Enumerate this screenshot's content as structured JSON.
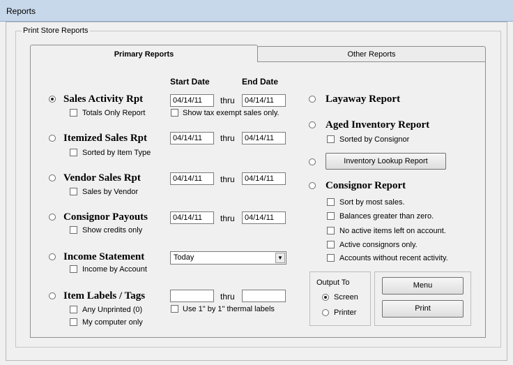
{
  "window": {
    "title": "Reports"
  },
  "group_label": "Print Store Reports",
  "tabs": [
    "Primary Reports",
    "Other Reports"
  ],
  "headers": {
    "start": "Start Date",
    "end": "End Date"
  },
  "thru": "thru",
  "left": [
    {
      "label": "Sales Activity Rpt",
      "checked": true,
      "option": "Totals Only Report",
      "start": "04/14/11",
      "end": "04/14/11",
      "extra": "Show tax exempt sales only."
    },
    {
      "label": "Itemized Sales Rpt",
      "checked": false,
      "option": "Sorted by Item Type",
      "start": "04/14/11",
      "end": "04/14/11"
    },
    {
      "label": "Vendor Sales Rpt",
      "checked": false,
      "option": "Sales by Vendor",
      "start": "04/14/11",
      "end": "04/14/11"
    },
    {
      "label": "Consignor Payouts",
      "checked": false,
      "option": "Show credits only",
      "start": "04/14/11",
      "end": "04/14/11"
    },
    {
      "label": "Income Statement",
      "checked": false,
      "option": "Income by Account",
      "select": "Today"
    },
    {
      "label": "Item Labels / Tags",
      "checked": false,
      "option": "Any Unprinted  (0)",
      "option2": "My computer only",
      "start": "",
      "end": "",
      "extra": "Use 1\" by 1\" thermal labels"
    }
  ],
  "right": {
    "layaway": "Layaway Report",
    "aged": "Aged Inventory Report",
    "aged_option": "Sorted by Consignor",
    "lookup_button": "Inventory Lookup Report",
    "consignor": "Consignor Report",
    "consignor_options": [
      "Sort by most sales.",
      "Balances greater than zero.",
      "No active items left on account.",
      "Active consignors only.",
      "Accounts without recent activity."
    ]
  },
  "output": {
    "title": "Output To",
    "screen": "Screen",
    "printer": "Printer",
    "selected": "Screen"
  },
  "buttons": {
    "menu": "Menu",
    "print": "Print"
  }
}
